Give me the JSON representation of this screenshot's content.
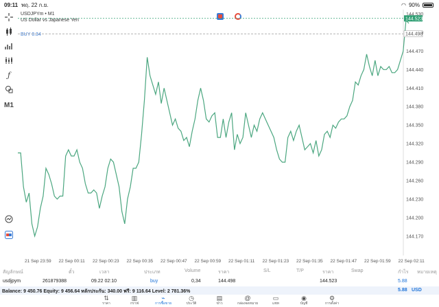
{
  "status_bar": {
    "time": "09:11",
    "date": "พฤ. 22 ก.ย.",
    "battery": "90%"
  },
  "chart_header": {
    "symbol": "USDJPYm • M1",
    "description": "US Dollar vs Japanese Yen",
    "buy_label": "BUY 0.34",
    "current_price": "144.523",
    "buy_price": "144.498"
  },
  "toolbar": {
    "crosshair": "crosshair-icon",
    "chart_type": "candlestick-icon",
    "indicators": "indicators-icon",
    "objects": "objects-icon",
    "function": "function-icon",
    "shapes": "shapes-icon",
    "timeframe": "M1"
  },
  "chart_data": {
    "type": "line",
    "title": "",
    "y_ticks": [
      "144.530",
      "144.500",
      "144.470",
      "144.440",
      "144.410",
      "144.380",
      "144.350",
      "144.320",
      "144.290",
      "144.260",
      "144.230",
      "144.200",
      "144.170"
    ],
    "x_ticks": [
      "21 Sep 23:59",
      "22 Sep 00:11",
      "22 Sep 00:23",
      "22 Sep 00:35",
      "22 Sep 00:47",
      "22 Sep 00:59",
      "22 Sep 01:11",
      "22 Sep 01:23",
      "22 Sep 01:35",
      "22 Sep 01:47",
      "22 Sep 01:59",
      "22 Sep 02:11"
    ],
    "ylim": [
      144.152,
      144.535
    ],
    "bid_line": 144.523,
    "buy_line": 144.498,
    "line_color": "#4aa67f",
    "series": [
      {
        "values": [
          144.305,
          144.305,
          144.25,
          144.225,
          144.24,
          144.19,
          144.17,
          144.185,
          144.215,
          144.235,
          144.28,
          144.27,
          144.255,
          144.235,
          144.23,
          144.235,
          144.235,
          144.3,
          144.31,
          144.3,
          144.3,
          144.31,
          144.29,
          144.28,
          144.255,
          144.24,
          144.24,
          144.245,
          144.24,
          144.215,
          144.235,
          144.25,
          144.28,
          144.295,
          144.29,
          144.27,
          144.25,
          144.21,
          144.19,
          144.23,
          144.25,
          144.28,
          144.28,
          144.29,
          144.335,
          144.39,
          144.46,
          144.43,
          144.415,
          144.4,
          144.42,
          144.385,
          144.41,
          144.39,
          144.37,
          144.35,
          144.36,
          144.345,
          144.34,
          144.325,
          144.33,
          144.315,
          144.34,
          144.36,
          144.39,
          144.41,
          144.39,
          144.36,
          144.355,
          144.365,
          144.37,
          144.33,
          144.33,
          144.36,
          144.33,
          144.355,
          144.37,
          144.31,
          144.335,
          144.32,
          144.33,
          144.37,
          144.35,
          144.33,
          144.35,
          144.34,
          144.36,
          144.37,
          144.36,
          144.35,
          144.34,
          144.33,
          144.31,
          144.295,
          144.29,
          144.29,
          144.33,
          144.34,
          144.325,
          144.34,
          144.35,
          144.33,
          144.31,
          144.315,
          144.32,
          144.305,
          144.325,
          144.3,
          144.31,
          144.335,
          144.34,
          144.33,
          144.35,
          144.345,
          144.355,
          144.36,
          144.36,
          144.365,
          144.38,
          144.39,
          144.42,
          144.415,
          144.43,
          144.44,
          144.465,
          144.445,
          144.43,
          144.455,
          144.43,
          144.445,
          144.44,
          144.44,
          144.445,
          144.435,
          144.435,
          144.44,
          144.455,
          144.47,
          144.52,
          144.515
        ]
      }
    ]
  },
  "table": {
    "headers": [
      "สัญลักษณ์",
      "ตั๋ว",
      "เวลา",
      "ประเภท",
      "Volume",
      "ราคา",
      "S/L",
      "T/P",
      "ราคา",
      "Swap",
      "กำไร",
      "หมายเหตุ"
    ],
    "row": {
      "symbol": "usdjpym",
      "ticket": "261879388",
      "time": "09.22 02:10",
      "type": "buy",
      "volume": "0,34",
      "price": "144.498",
      "current_price": "144.523",
      "profit": "5.88"
    }
  },
  "balance_bar": {
    "text": "Balance: 9 450.76 Equity: 9 456.64 หลักประกัน: 340.00 ฟรี: 9 116.64 Level: 2 781.36%",
    "profit": "5.88",
    "currency": "USD"
  },
  "tabs": [
    {
      "label": "ราคา",
      "icon": "arrows-updown-icon"
    },
    {
      "label": "กราฟ",
      "icon": "chart-icon"
    },
    {
      "label": "การซื้อขาย",
      "icon": "trade-icon",
      "active": true
    },
    {
      "label": "ประวัติ",
      "icon": "history-icon"
    },
    {
      "label": "ข่าว",
      "icon": "news-icon"
    },
    {
      "label": "กล่องจดหมาย",
      "icon": "mailbox-icon"
    },
    {
      "label": "แชท",
      "icon": "chat-icon"
    },
    {
      "label": "บัญชี",
      "icon": "account-icon"
    },
    {
      "label": "การตั้งค่า",
      "icon": "settings-icon"
    }
  ],
  "colors": {
    "accent": "#1e73d8",
    "line": "#4aa67f",
    "bid_label_bg": "#2e9e72"
  }
}
